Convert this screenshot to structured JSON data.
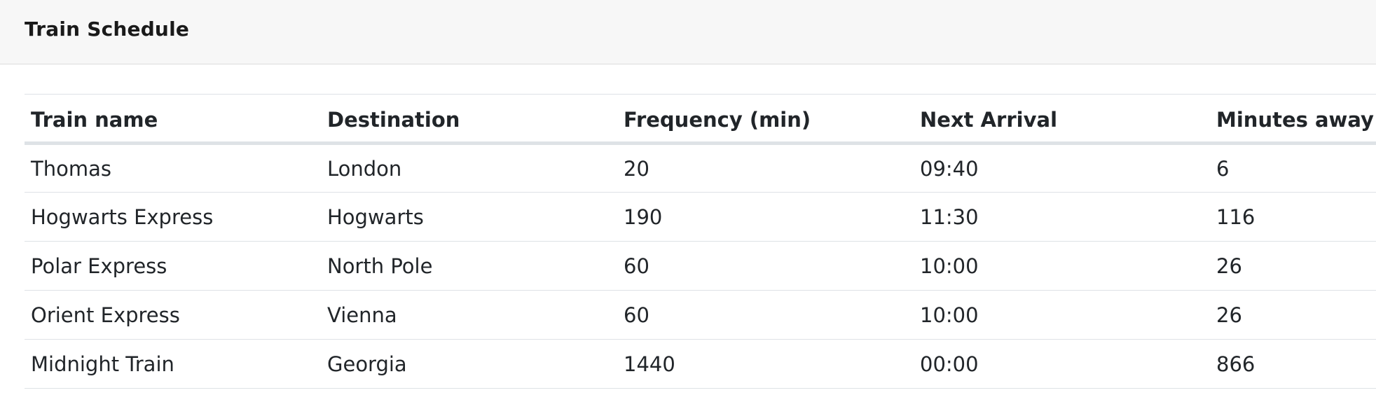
{
  "header": {
    "title": "Train Schedule"
  },
  "table": {
    "columns": [
      "Train name",
      "Destination",
      "Frequency (min)",
      "Next Arrival",
      "Minutes away"
    ],
    "rows": [
      [
        "Thomas",
        "London",
        "20",
        "09:40",
        "6"
      ],
      [
        "Hogwarts Express",
        "Hogwarts",
        "190",
        "11:30",
        "116"
      ],
      [
        "Polar Express",
        "North Pole",
        "60",
        "10:00",
        "26"
      ],
      [
        "Orient Express",
        "Vienna",
        "60",
        "10:00",
        "26"
      ],
      [
        "Midnight Train",
        "Georgia",
        "1440",
        "00:00",
        "866"
      ]
    ]
  }
}
